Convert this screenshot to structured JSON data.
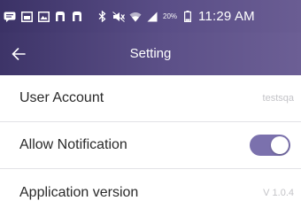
{
  "status_bar": {
    "icons_left": [
      "message-icon",
      "image-icon",
      "gallery-icon",
      "notification-icon",
      "notification-icon"
    ],
    "icons_right": [
      "bluetooth-icon",
      "mute-icon",
      "wifi-icon",
      "signal-icon",
      "battery-icon"
    ],
    "battery_percent": "20%",
    "time": "11:29 AM"
  },
  "header": {
    "back_icon": "arrow-left-icon",
    "title": "Setting"
  },
  "settings": {
    "items": [
      {
        "label": "User Account",
        "value": "testsqa"
      },
      {
        "label": "Allow Notification",
        "toggle_on": true
      },
      {
        "label": "Application version",
        "value": "V 1.0.4"
      }
    ]
  },
  "colors": {
    "header_gradient_start": "#3d3468",
    "header_gradient_end": "#6c5f95",
    "toggle_on": "#7b71ad",
    "value_text": "#c4c4c8",
    "label_text": "#2a2a2a"
  }
}
